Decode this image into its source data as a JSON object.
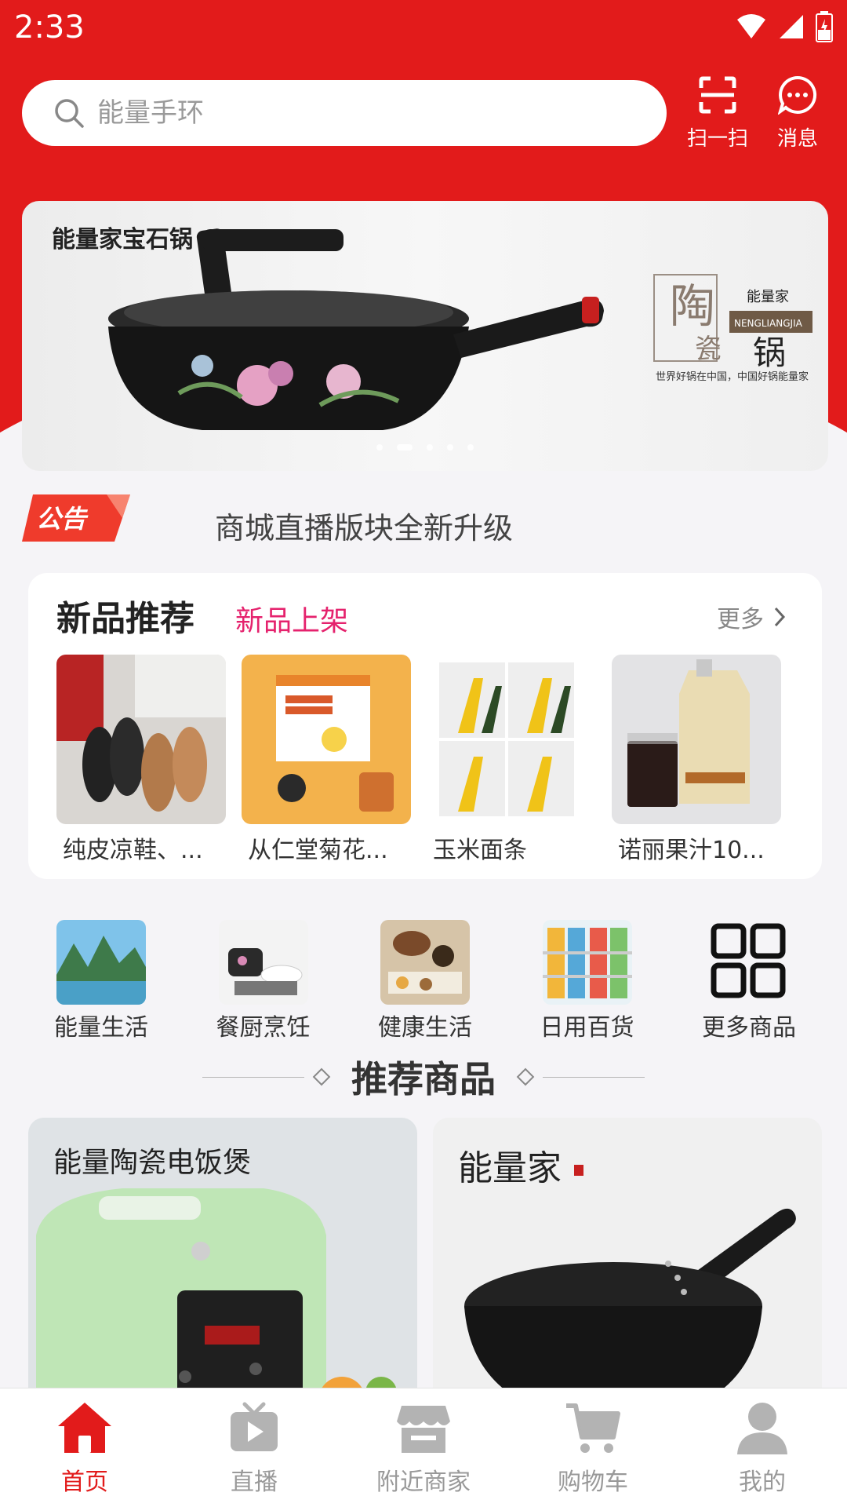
{
  "status_bar": {
    "time": "2:33"
  },
  "header": {
    "search_placeholder": "能量手环",
    "scan_label": "扫一扫",
    "message_label": "消息"
  },
  "banner": {
    "title": "能量家宝石锅",
    "brand_lines": [
      "陶",
      "瓷",
      "能量家",
      "NENGLIANGJIA",
      "锅",
      "世界好锅在中国，中国好锅能量家"
    ],
    "active_dot": 1,
    "dot_count": 5
  },
  "notice": {
    "badge": "公告",
    "text": "商城直播版块全新升级"
  },
  "new_products": {
    "title": "新品推荐",
    "subtitle": "新品上架",
    "more_label": "更多",
    "items": [
      {
        "name": "纯皮凉鞋、..."
      },
      {
        "name": "从仁堂菊花..."
      },
      {
        "name": "玉米面条"
      },
      {
        "name": "诺丽果汁10..."
      }
    ]
  },
  "categories": [
    {
      "label": "能量生活",
      "icon": "landscape-image"
    },
    {
      "label": "餐厨烹饪",
      "icon": "cookware-image"
    },
    {
      "label": "健康生活",
      "icon": "tea-set-image"
    },
    {
      "label": "日用百货",
      "icon": "supermarket-image"
    },
    {
      "label": "更多商品",
      "icon": "grid-icon"
    }
  ],
  "recommended": {
    "title": "推荐商品",
    "items": [
      {
        "title": "能量陶瓷电饭煲"
      },
      {
        "title": "能量家"
      }
    ]
  },
  "bottom_nav": [
    {
      "label": "首页",
      "icon": "home-icon",
      "active": true
    },
    {
      "label": "直播",
      "icon": "tv-play-icon",
      "active": false
    },
    {
      "label": "附近商家",
      "icon": "store-icon",
      "active": false
    },
    {
      "label": "购物车",
      "icon": "cart-icon",
      "active": false
    },
    {
      "label": "我的",
      "icon": "user-icon",
      "active": false
    }
  ],
  "colors": {
    "primary": "#e21b1b",
    "accent": "#e5226d",
    "background": "#f5f4f7"
  }
}
